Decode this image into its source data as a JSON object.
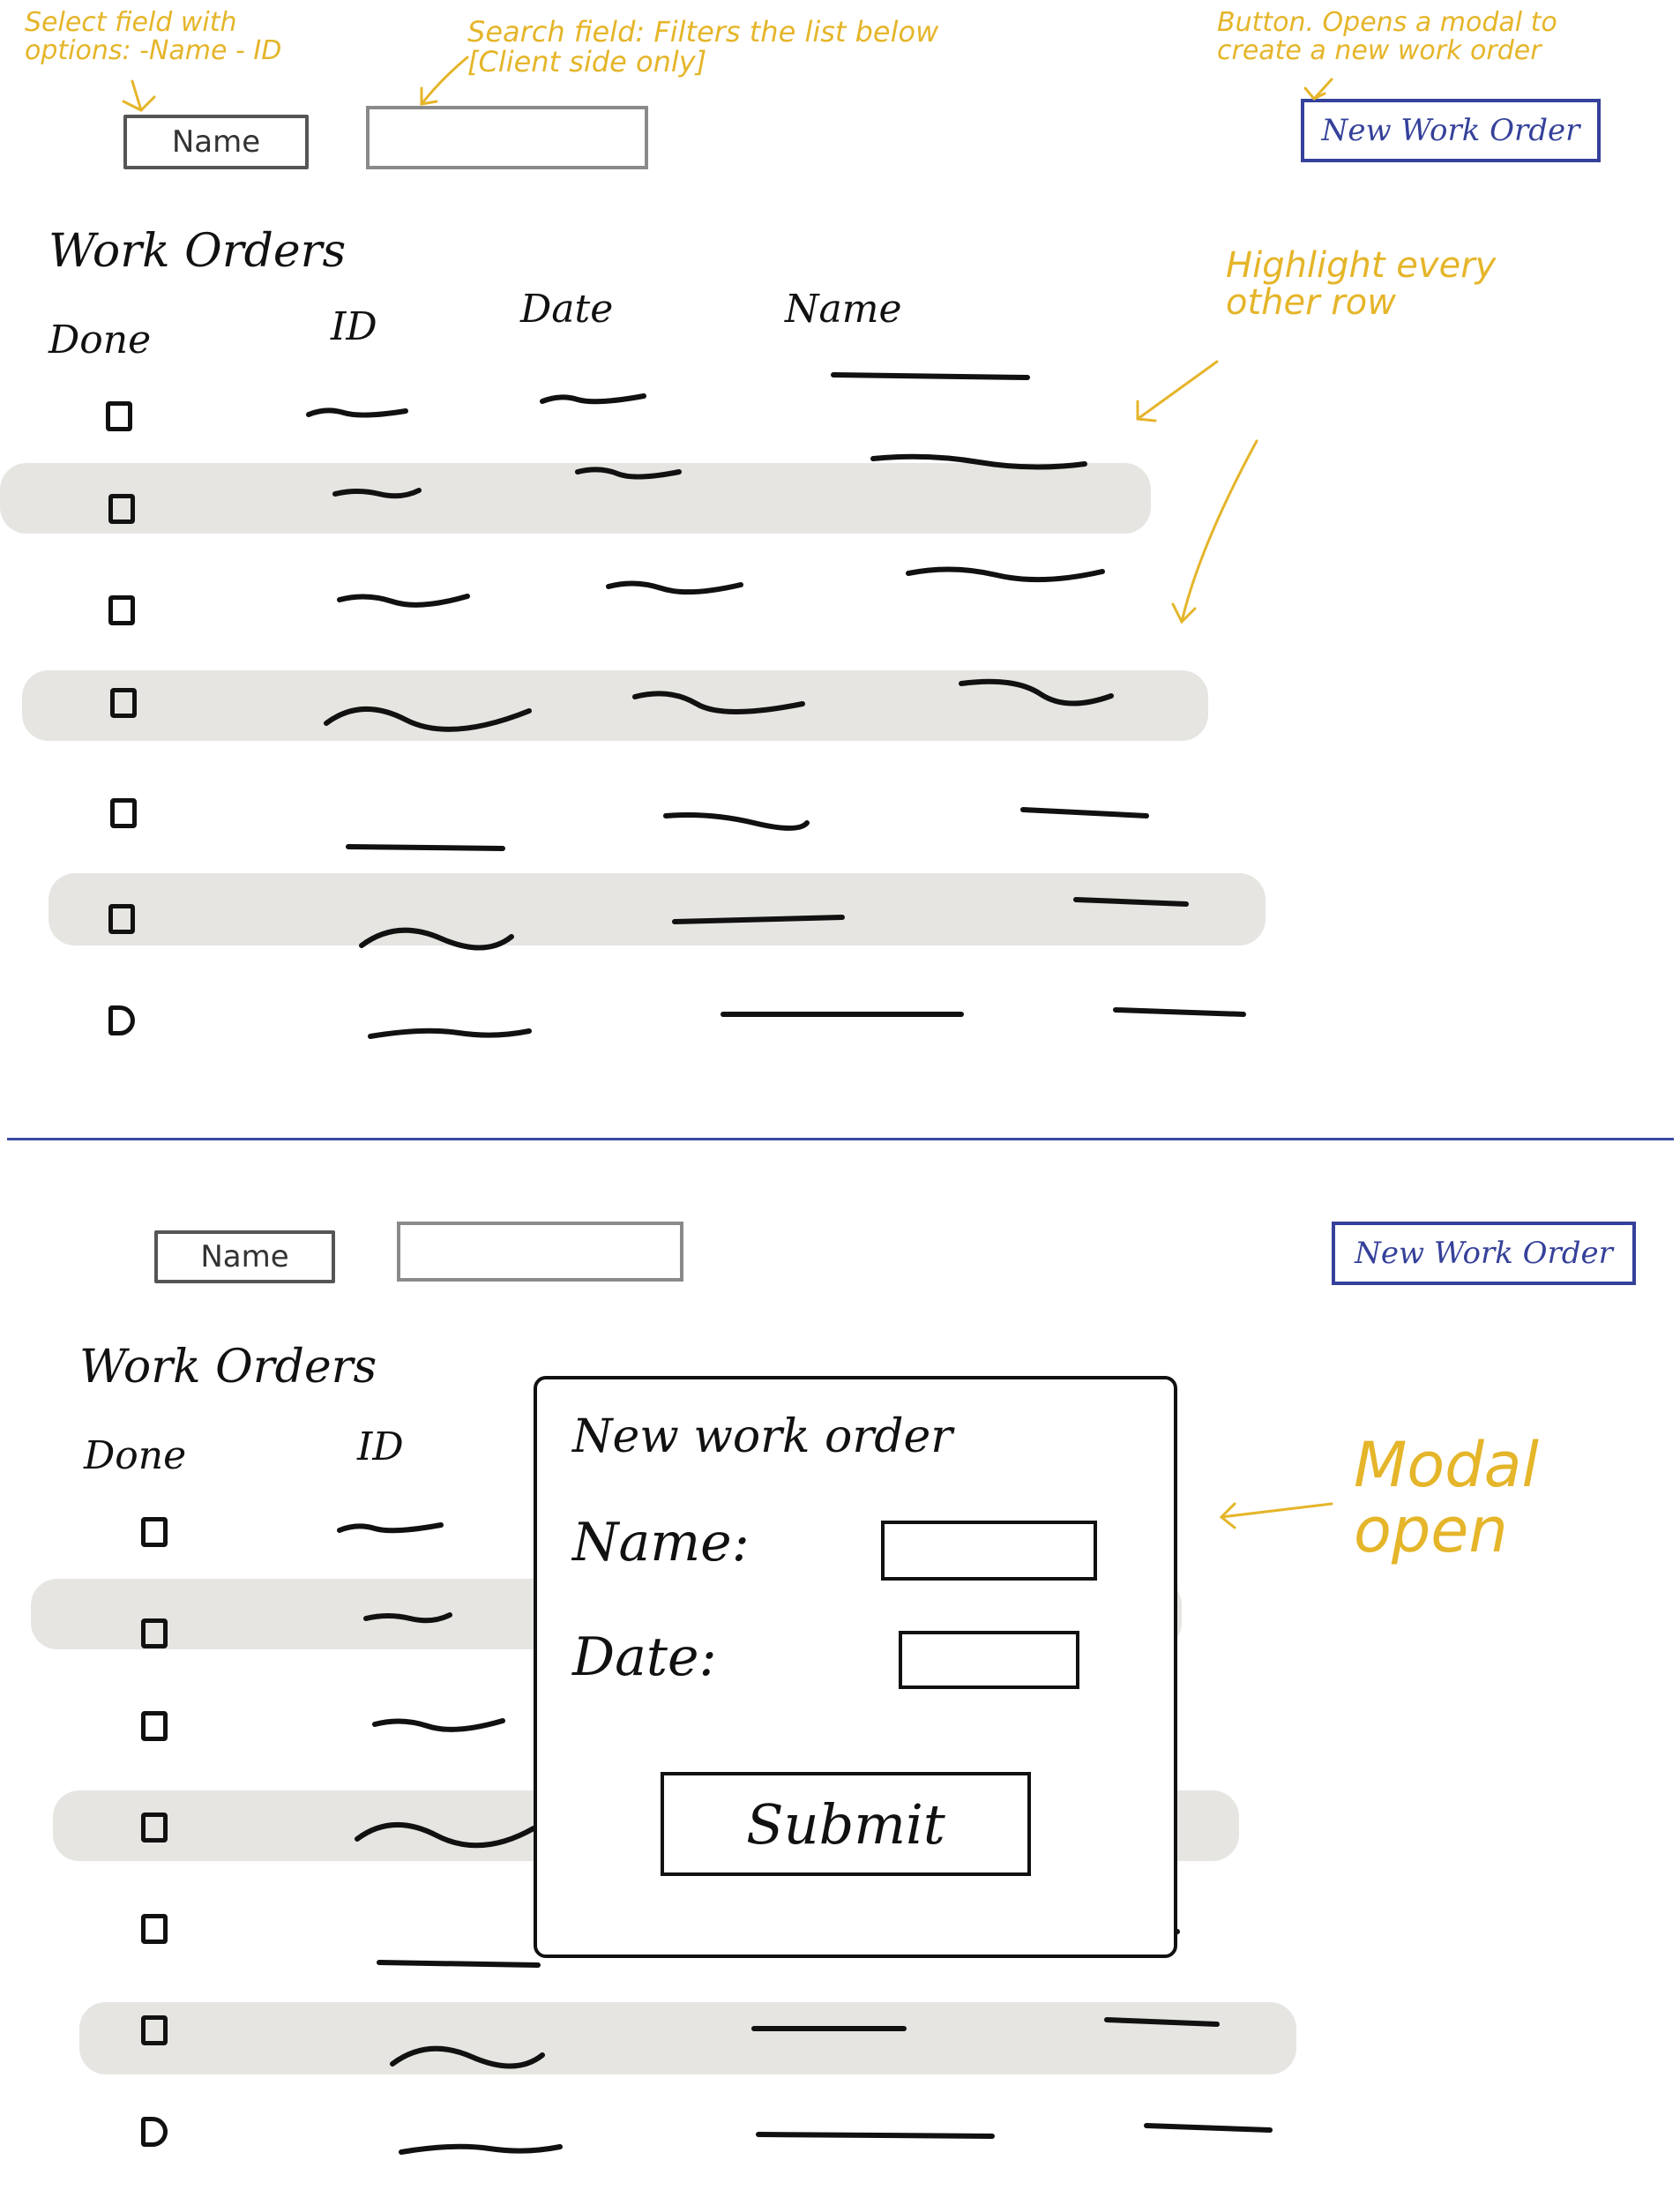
{
  "top_panel": {
    "annotations": {
      "select_note": "Select field with options: -Name - ID",
      "search_note": "Search field: Filters the list below [Client side only]",
      "button_note": "Button. Opens a modal to create a new work order",
      "rows_note": "Highlight every other row"
    },
    "toolbar": {
      "select_value": "Name",
      "search_value": "",
      "new_button_label": "New Work Order"
    },
    "list": {
      "title": "Work Orders",
      "columns": [
        "Done",
        "ID",
        "Date",
        "Name"
      ],
      "row_count": 7
    }
  },
  "bottom_panel": {
    "annotations": {
      "modal_note": "Modal open"
    },
    "toolbar": {
      "select_value": "Name",
      "search_value": "",
      "new_button_label": "New Work Order"
    },
    "list": {
      "title": "Work Orders",
      "columns": [
        "Done",
        "ID"
      ],
      "row_count": 7
    },
    "modal": {
      "title": "New work order",
      "name_label": "Name:",
      "date_label": "Date:",
      "submit_label": "Submit"
    }
  },
  "colors": {
    "annotation": "#e5b52a",
    "button": "#35419a",
    "row_highlight": "#e6e5e2",
    "divider": "#3a4ba0"
  }
}
